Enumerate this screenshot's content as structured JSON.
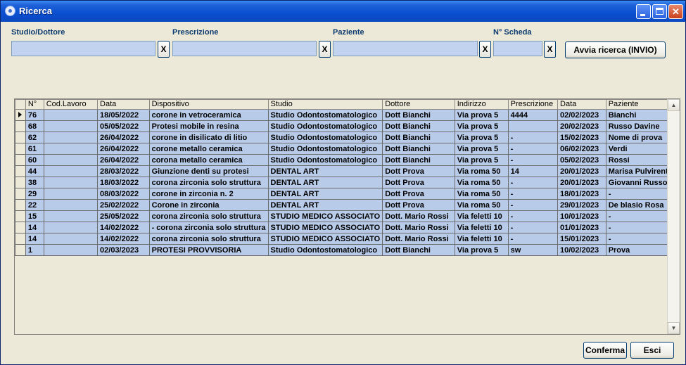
{
  "window": {
    "title": "Ricerca"
  },
  "filters": {
    "studio_label": "Studio/Dottore",
    "prescrizione_label": "Prescrizione",
    "paziente_label": "Paziente",
    "scheda_label": "N° Scheda",
    "studio_value": "",
    "prescrizione_value": "",
    "paziente_value": "",
    "scheda_value": "",
    "clear_label": "X",
    "search_button": "Avvia ricerca (INVIO)"
  },
  "grid": {
    "columns": [
      "N°",
      "Cod.Lavoro",
      "Data",
      "Dispositivo",
      "Studio",
      "Dottore",
      "Indirizzo",
      "Prescrizione",
      "Data",
      "Paziente"
    ],
    "rows": [
      [
        "76",
        "",
        "18/05/2022",
        "corone in vetroceramica",
        "Studio Odontostomatologico",
        "Dott Bianchi",
        "Via prova 5",
        "4444",
        "02/02/2023",
        "Bianchi"
      ],
      [
        "68",
        "",
        "05/05/2022",
        "Protesi mobile in resina",
        "Studio Odontostomatologico",
        "Dott Bianchi",
        "Via prova 5",
        "",
        "20/02/2023",
        "Russo Davine"
      ],
      [
        "62",
        "",
        "26/04/2022",
        "corone in disilicato di litio",
        "Studio Odontostomatologico",
        "Dott Bianchi",
        "Via prova 5",
        "-",
        "15/02/2023",
        "Nome di prova"
      ],
      [
        "61",
        "",
        "26/04/2022",
        "corone metallo ceramica",
        "Studio Odontostomatologico",
        "Dott Bianchi",
        "Via prova 5",
        "-",
        "06/02/2023",
        "Verdi"
      ],
      [
        "60",
        "",
        "26/04/2022",
        "corona metallo ceramica",
        "Studio Odontostomatologico",
        "Dott Bianchi",
        "Via prova 5",
        "-",
        "05/02/2023",
        "Rossi"
      ],
      [
        "44",
        "",
        "28/03/2022",
        "Giunzione denti su protesi",
        "DENTAL ART",
        "Dott Prova",
        "Via roma 50",
        "14",
        "20/01/2023",
        "Marisa Pulvirenti"
      ],
      [
        "38",
        "",
        "18/03/2022",
        "corona zirconia solo struttura",
        "DENTAL ART",
        "Dott Prova",
        "Via roma 50",
        "-",
        "20/01/2023",
        "Giovanni Russo"
      ],
      [
        "29",
        "",
        "08/03/2022",
        "corone in zirconia n. 2",
        "DENTAL ART",
        "Dott Prova",
        "Via roma 50",
        "-",
        "18/01/2023",
        "-"
      ],
      [
        "22",
        "",
        "25/02/2022",
        "Corone in zirconia",
        "DENTAL ART",
        "Dott Prova",
        "Via roma 50",
        "-",
        "29/01/2023",
        "De blasio Rosa"
      ],
      [
        "15",
        "",
        "25/05/2022",
        "corona zirconia solo struttura",
        "STUDIO  MEDICO ASSOCIATO",
        "Dott. Mario Rossi",
        "Via feletti 10",
        "-",
        "10/01/2023",
        "-"
      ],
      [
        "14",
        "",
        "14/02/2022",
        "  - corona zirconia solo struttura",
        "STUDIO  MEDICO ASSOCIATO",
        "Dott. Mario Rossi",
        "Via feletti 10",
        "-",
        "01/01/2023",
        "-"
      ],
      [
        "14",
        "",
        "14/02/2022",
        "corona zirconia solo struttura",
        "STUDIO  MEDICO ASSOCIATO",
        "Dott. Mario Rossi",
        "Via feletti 10",
        "-",
        "15/01/2023",
        "-"
      ],
      [
        "1",
        "",
        "02/03/2023",
        "PROTESI PROVVISORIA",
        "Studio Odontostomatologico",
        "Dott Bianchi",
        "Via prova 5",
        "sw",
        "10/02/2023",
        "Prova"
      ]
    ]
  },
  "footer": {
    "confirm_button": "Conferma",
    "exit_button": "Esci"
  }
}
